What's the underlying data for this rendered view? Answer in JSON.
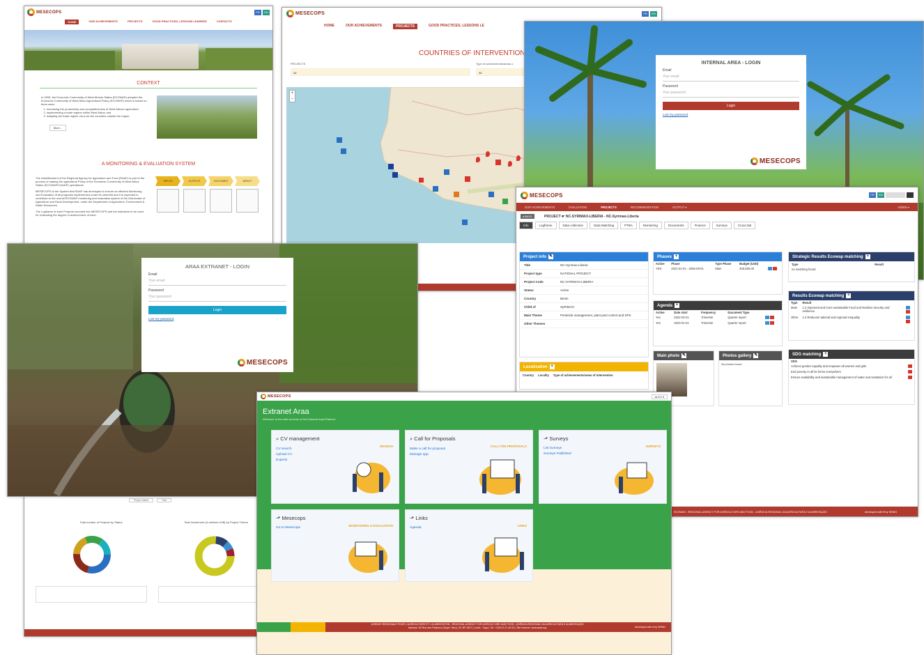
{
  "logo_text": "MESECOPS",
  "flags": [
    "FR",
    "EN"
  ],
  "win1": {
    "nav": [
      "HOME",
      "OUR ACHIEVEMENTS",
      "PROJECTS",
      "GOOD PRACTICES, LESSONS LEARNED",
      "CONTACTS"
    ],
    "context_title": "CONTEXT",
    "context_text": "In 2005, the Economic Community of West African States (ECOWAS) adopted the Economic Community of West Africa Agricultural Policy (ECOWAP) which is based on three axes:",
    "bullets": [
      "increasing the productivity and competitiveness of West African agriculture;",
      "implementing a trade regime within West Africa; and",
      "adapting the trade regime vis-à-vis the countries outside the region."
    ],
    "more_label": "More...",
    "me_title": "A MONITORING & EVALUATION SYSTEM",
    "me_text1": "The establishment of the Regional Agency for Agriculture and Food (RAAF) is part of the process of making the agricultural Policy of the Economic Community of West Africa States (ECOWAP/CAADP) operational.",
    "me_text2": "MESECOPS is the System that RAAF has developed to ensure an efficient Monitoring and Evaluation of all programs implemented under its umbrella and it is expected to contribute to the overall ECOWAP monitoring and evaluation system of the Directorate of Agriculture and Rural Development, under the Department of Agriculture, Environment & Water Resources.",
    "me_text3": "The Logframe of each Projects encoded into MESECOPS and the indicators to be used for evaluating the degree of achievement of each",
    "steps": [
      "INPUTS",
      "OUTPUTS",
      "OUTCOMES",
      "IMPACT"
    ],
    "chart1_title": "Total number of Projects by Status",
    "chart2_title": "Total Investment (in millions US$) by Project Theme",
    "chart_filter": [
      "Project status",
      "Year"
    ]
  },
  "win2": {
    "nav": [
      "HOME",
      "OUR ACHIEVEMENTS",
      "PROJECTS",
      "GOOD PRACTICES, LESSONS LE"
    ],
    "title": "COUNTRIES OF INTERVENTION",
    "f1_label": "PROJECTS",
    "f1_value": "All",
    "f2_label": "Type of achievements/areas o",
    "f2_value": "All",
    "zoom_in": "+",
    "zoom_out": "−"
  },
  "win3": {
    "title": "INTERNAL AREA - LOGIN",
    "email_label": "Email",
    "email_placeholder": "Your email",
    "password_label": "Password",
    "password_placeholder": "Your password",
    "login": "Login",
    "lost": "Lost my password"
  },
  "win4": {
    "nav": [
      "OUR ACHIEVEMENTS",
      "EVALUATION",
      "PROJECTS",
      "RECOMMENDATION",
      "OUTPUT ▾"
    ],
    "admin": "ADMIN ▾",
    "back": "◂ BACK",
    "crumb": "PROJECT ☛ NC-SYRIMAO-LIBERIA - NC-Syrimao-Liberia",
    "tabs": [
      "Info",
      "Logframe",
      "Data collection",
      "Data Matching",
      "PTBA",
      "Monitoring",
      "Documents",
      "Finance",
      "Surveys",
      "Cross tab"
    ],
    "info_title": "Project info",
    "info": [
      {
        "k": "Title",
        "v": "NC-Syrimao-Liberia"
      },
      {
        "k": "Project type",
        "v": "NATIONAL PROJECT"
      },
      {
        "k": "Project Code",
        "v": "NC-SYRIMAO-LIBERIA"
      },
      {
        "k": "Status",
        "v": "Active"
      },
      {
        "k": "Country",
        "v": "Benin"
      },
      {
        "k": "Child of",
        "v": "SyRIMAO"
      },
      {
        "k": "Main Theme",
        "v": "Pesticide management, plant pest control and SPS"
      },
      {
        "k": "Other Themes",
        "v": ""
      }
    ],
    "loc_title": "Localization",
    "loc_cols": [
      "Country",
      "Locality",
      "Type of achievements/areas of intervention"
    ],
    "phases_title": "Phases",
    "phases_cols": [
      "Active",
      "Phase",
      "Type Phase",
      "Budget (USD)"
    ],
    "phases_row": [
      "YES",
      "2021-01-01 - 2026-09-01",
      "Main",
      "400,000.00"
    ],
    "agenda_title": "Agenda",
    "agenda_cols": [
      "Active",
      "Date start",
      "Frequency",
      "Document Type"
    ],
    "agenda_rows": [
      [
        "Yes",
        "2022-03-01",
        "Trimestre",
        "Quarter report"
      ],
      [
        "Yes",
        "2023-01-01",
        "Trimestre",
        "Quarter report"
      ]
    ],
    "photo_title": "Main photo",
    "gallery_title": "Photos gallery",
    "gallery_empty": "No photos found",
    "strat_title": "Strategic Results Ecowap matching",
    "strat_cols": [
      "Type",
      "Result"
    ],
    "strat_empty": "no matching found",
    "results_title": "Results Ecowap matching",
    "results_rows": [
      [
        "Main",
        "1.2 Improved and more sustainable Food and Nutrition security and resilience"
      ],
      [
        "Other",
        "1.3 Reduced national and regional inequality"
      ]
    ],
    "sdg_title": "SDG matching",
    "sdg_head": "SDG",
    "sdg_rows": [
      "Achieve gender equality and empower all women and girls",
      "End poverty in all its forms everywhere",
      "Ensure availability and sustainable management of water and sanitation for all"
    ],
    "footer": "ECOWAS - REGIONAL AGENCY FOR AGRICULTURE AND FOOD - AGÊNCIA REGIONAL DA AGRICULTURA E ALIMENTAÇÃO",
    "footer_right": "developed with ♥ by SENKI"
  },
  "win5": {
    "title": "ARAA EXTRANET - LOGIN",
    "email_label": "Email",
    "email_placeholder": "Your email",
    "password_label": "Password",
    "password_placeholder": "Your password",
    "login": "Login",
    "lost": "Lost my password"
  },
  "win6": {
    "user": "ALEX ▾",
    "title": "Extranet Araa",
    "subtitle": "Welcome to the web services of the Extranet Araa Platform",
    "cards": [
      {
        "title": "CV management",
        "tag": "SEARCH",
        "links": [
          "CV search",
          "Upload CV",
          "Experts"
        ]
      },
      {
        "title": "Call for Proposals",
        "tag": "CALL FOR PROPOSALS",
        "links": [
          "Make a call for proposal",
          "Manage app"
        ]
      },
      {
        "title": "Surveys",
        "tag": "SURVEYS",
        "links": [
          "List Surveys",
          "Surveys Published"
        ]
      },
      {
        "title": "Mesecops",
        "tag": "MONITORING & EVALUATION",
        "links": [
          "Go to Mesecops"
        ]
      },
      {
        "title": "Links",
        "tag": "LINKS",
        "links": [
          "Agenda"
        ]
      }
    ],
    "footer": "AGENCE RÉGIONALE POUR L'AGRICULTURE ET L'ALIMENTATION - REGIONAL AGENCY FOR AGRICULTURE AND FOOD - AGÊNCIA REGIONAL DA AGRICULTURA E ALIMENTAÇÃO",
    "footer2": "Adresse: 83 Rue des Pasteurs (Super Taco) | 01 BP 4817 | Lomé - Togo | Tél: +228 22 21 40 03 | Site internet: www.araa.org",
    "footer_right": "developed with ♥ by SENKI"
  },
  "colors": {
    "brand_red": "#b03a2e",
    "brand_green": "#3aa34a",
    "brand_yellow": "#e6a31e",
    "info_blue": "#2b7fd8",
    "dark_navy": "#2a3f6a"
  }
}
